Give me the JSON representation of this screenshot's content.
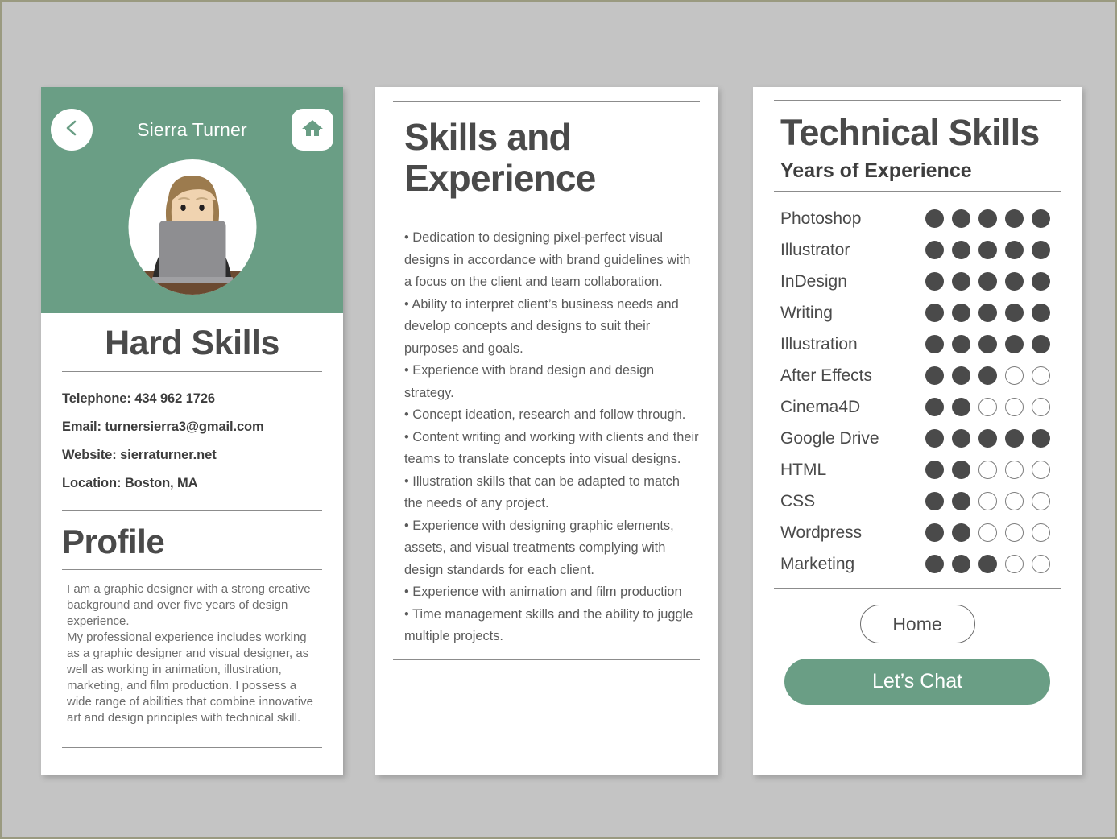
{
  "theme": {
    "accent_green": "#6a9e85",
    "text_dark": "#4a4a4a",
    "text_body": "#6d6d6d",
    "page_background": "#c4c4c4"
  },
  "profile_card": {
    "header": {
      "name": "Sierra Turner",
      "back_icon": "chevron-left-icon",
      "home_icon": "home-icon",
      "avatar_icon": "avatar-person-at-laptop"
    },
    "title": "Hard Skills",
    "contact": [
      "Telephone: 434 962 1726",
      "Email: turnersierra3@gmail.com",
      "Website: sierraturner.net",
      "Location: Boston, MA"
    ],
    "profile_title": "Profile",
    "profile_text": "I am a graphic designer with a strong creative background and over five years of design experience.\nMy professional experience includes working as a graphic designer and visual designer, as well as working in animation, illustration, marketing, and film production.  I possess a wide range of abilities that combine innovative art and design principles with technical skill."
  },
  "skills_card": {
    "title": "Skills and Experience",
    "bullets": [
      "• Dedication to designing pixel-perfect visual designs in accordance with brand guidelines with a focus on the client and team collaboration.",
      "• Ability to interpret client’s business needs and develop concepts and designs to suit their purposes and goals.",
      "• Experience with brand design and design strategy.",
      "• Concept ideation, research and follow through.",
      "• Content writing and working with clients and their teams to translate concepts into visual designs.",
      "• Illustration skills that can be adapted to match the needs of any project.",
      "• Experience with designing graphic elements, assets, and visual treatments complying with design standards for each client.",
      "• Experience with animation and film production",
      "• Time management skills and the ability to juggle multiple projects."
    ]
  },
  "technical_card": {
    "title": "Technical Skills",
    "subtitle": "Years of Experience",
    "max_rating": 5,
    "skills": [
      {
        "name": "Photoshop",
        "rating": 5
      },
      {
        "name": "Illustrator",
        "rating": 5
      },
      {
        "name": "InDesign",
        "rating": 5
      },
      {
        "name": "Writing",
        "rating": 5
      },
      {
        "name": "Illustration",
        "rating": 5
      },
      {
        "name": "After Effects",
        "rating": 3
      },
      {
        "name": "Cinema4D",
        "rating": 2
      },
      {
        "name": "Google Drive",
        "rating": 5
      },
      {
        "name": "HTML",
        "rating": 2
      },
      {
        "name": "CSS",
        "rating": 2
      },
      {
        "name": "Wordpress",
        "rating": 2
      },
      {
        "name": "Marketing",
        "rating": 3
      }
    ],
    "home_button": "Home",
    "chat_button": "Let’s Chat"
  }
}
